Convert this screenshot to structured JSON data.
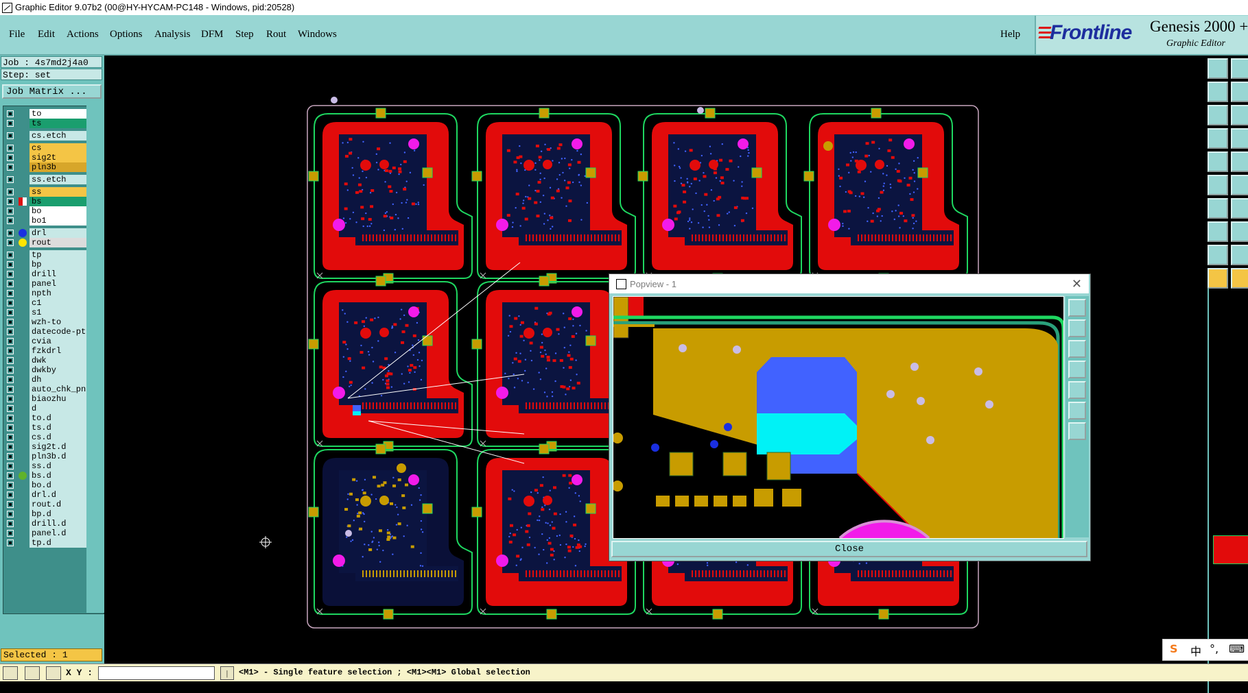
{
  "window": {
    "title": "Graphic Editor 9.07b2 (00@HY-HYCAM-PC148 - Windows, pid:20528)"
  },
  "menu": {
    "items": [
      "File",
      "Edit",
      "Actions",
      "Options",
      "Analysis",
      "DFM",
      "Step",
      "Rout",
      "Windows"
    ],
    "help": "Help"
  },
  "brand": {
    "logo": "Frontline",
    "product": "Genesis 2000 +",
    "subtitle": "Graphic Editor"
  },
  "job": {
    "job_label": "Job : 4s7md2j4a0",
    "step_label": "Step: set",
    "matrix_button": "Job Matrix ..."
  },
  "layers": [
    {
      "name": "to",
      "color": "#ffffff"
    },
    {
      "name": "ts",
      "color": "#1a9e6e"
    },
    {
      "name": "cs.etch",
      "color": "#c7e8e6"
    },
    {
      "name": "cs",
      "color": "#f4c545"
    },
    {
      "name": "sig2t",
      "color": "#f4c545"
    },
    {
      "name": "pln3b",
      "color": "#d7a62a"
    },
    {
      "name": "ss.etch",
      "color": "#c7e8e6"
    },
    {
      "name": "ss",
      "color": "#f4c545"
    },
    {
      "name": "bs",
      "color": "#1a9e6e"
    },
    {
      "name": "bo",
      "color": "#ffffff"
    },
    {
      "name": "bo1",
      "color": "#ffffff"
    },
    {
      "name": "drl",
      "color": "#c7e8e6"
    },
    {
      "name": "rout",
      "color": "#dcdcdc"
    },
    {
      "name": "tp",
      "color": "#c7e8e6"
    },
    {
      "name": "bp",
      "color": "#c7e8e6"
    },
    {
      "name": "drill",
      "color": "#c7e8e6"
    },
    {
      "name": "panel",
      "color": "#c7e8e6"
    },
    {
      "name": "npth",
      "color": "#c7e8e6"
    },
    {
      "name": "c1",
      "color": "#c7e8e6"
    },
    {
      "name": "s1",
      "color": "#c7e8e6"
    },
    {
      "name": "wzh-to",
      "color": "#c7e8e6"
    },
    {
      "name": "datecode-pte",
      "color": "#c7e8e6"
    },
    {
      "name": "cvia",
      "color": "#c7e8e6"
    },
    {
      "name": "fzkdrl",
      "color": "#c7e8e6"
    },
    {
      "name": "dwk",
      "color": "#c7e8e6"
    },
    {
      "name": "dwkby",
      "color": "#c7e8e6"
    },
    {
      "name": "dh",
      "color": "#c7e8e6"
    },
    {
      "name": "auto_chk_pn",
      "color": "#c7e8e6"
    },
    {
      "name": "biaozhu",
      "color": "#c7e8e6"
    },
    {
      "name": "d",
      "color": "#c7e8e6"
    },
    {
      "name": "to.d",
      "color": "#c7e8e6"
    },
    {
      "name": "ts.d",
      "color": "#c7e8e6"
    },
    {
      "name": "cs.d",
      "color": "#c7e8e6"
    },
    {
      "name": "sig2t.d",
      "color": "#c7e8e6"
    },
    {
      "name": "pln3b.d",
      "color": "#c7e8e6"
    },
    {
      "name": "ss.d",
      "color": "#c7e8e6"
    },
    {
      "name": "bs.d",
      "color": "#c7e8e6"
    },
    {
      "name": "bo.d",
      "color": "#c7e8e6"
    },
    {
      "name": "drl.d",
      "color": "#c7e8e6"
    },
    {
      "name": "rout.d",
      "color": "#c7e8e6"
    },
    {
      "name": "bp.d",
      "color": "#c7e8e6"
    },
    {
      "name": "drill.d",
      "color": "#c7e8e6"
    },
    {
      "name": "panel.d",
      "color": "#c7e8e6"
    },
    {
      "name": "tp.d",
      "color": "#c7e8e6"
    }
  ],
  "status": {
    "selected": "Selected : 1",
    "xy_label": "X Y :",
    "xy_value": "",
    "message": "<M1> - Single feature selection ; <M1><M1> Global selection"
  },
  "popview": {
    "title": "Popview - 1",
    "close_label": "Close"
  },
  "ime": {
    "label": "中"
  }
}
